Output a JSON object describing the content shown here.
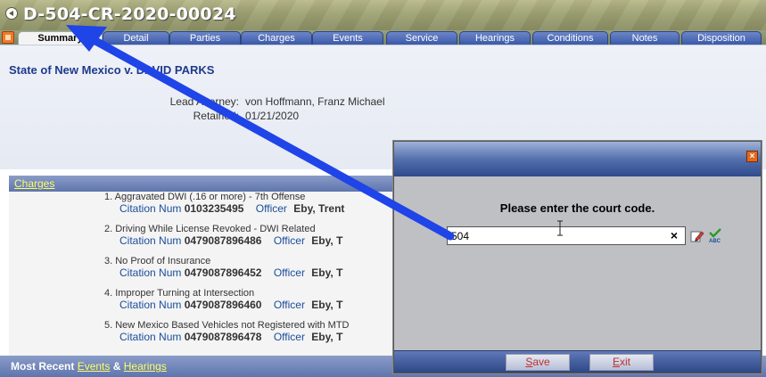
{
  "window": {
    "title": "D-504-CR-2020-00024"
  },
  "tabs": [
    {
      "label": "Summary",
      "active": true
    },
    {
      "label": "Detail"
    },
    {
      "label": "Parties"
    },
    {
      "label": "Charges"
    },
    {
      "label": "Events"
    },
    {
      "label": "Service"
    },
    {
      "label": "Hearings"
    },
    {
      "label": "Conditions"
    },
    {
      "label": "Notes"
    },
    {
      "label": "Disposition"
    }
  ],
  "summary": {
    "party_title": "State of New Mexico v. DAVID PARKS",
    "lead_attorney_label": "Lead Attorney:",
    "lead_attorney_value": "von Hoffmann, Franz Michael",
    "retained_label": "Retained:",
    "retained_value": "01/21/2020"
  },
  "charges": {
    "header_link": "Charges",
    "citation_label": "Citation Num",
    "officer_label": "Officer",
    "items": [
      {
        "title": "1. Aggravated DWI (.16 or more) - 7th Offense",
        "citation": "0103235495",
        "officer": "Eby, Trent"
      },
      {
        "title": "2. Driving While License Revoked - DWI Related",
        "citation": "0479087896486",
        "officer": "Eby, T"
      },
      {
        "title": "3. No Proof of Insurance",
        "citation": "0479087896452",
        "officer": "Eby, T"
      },
      {
        "title": "4. Improper Turning at Intersection",
        "citation": "0479087896460",
        "officer": "Eby, T"
      },
      {
        "title": "5. New Mexico Based Vehicles not Registered with MTD",
        "citation": "0479087896478",
        "officer": "Eby, T"
      }
    ]
  },
  "bottom": {
    "prefix": "Most Recent",
    "events_link": "Events",
    "amp": "&",
    "hearings_link": "Hearings"
  },
  "dialog": {
    "close_glyph": "×",
    "prompt": "Please enter the court code.",
    "input_value": "504",
    "clear_glyph": "×",
    "save_label": "Save",
    "save_accel": "S",
    "save_rest": "ave",
    "exit_label": "Exit",
    "exit_accel": "E",
    "exit_rest": "xit"
  },
  "colors": {
    "accent_blue": "#2d4ef0",
    "link_yellow": "#ffff66",
    "party_blue": "#1f3a8a"
  },
  "icons": {
    "title": "back-arrow-icon",
    "home_tab": "home-tab-icon",
    "edit": "edit-pencil-icon",
    "spellcheck": "spellcheck-abc-icon",
    "close": "close-icon",
    "cursor": "text-cursor-icon"
  }
}
